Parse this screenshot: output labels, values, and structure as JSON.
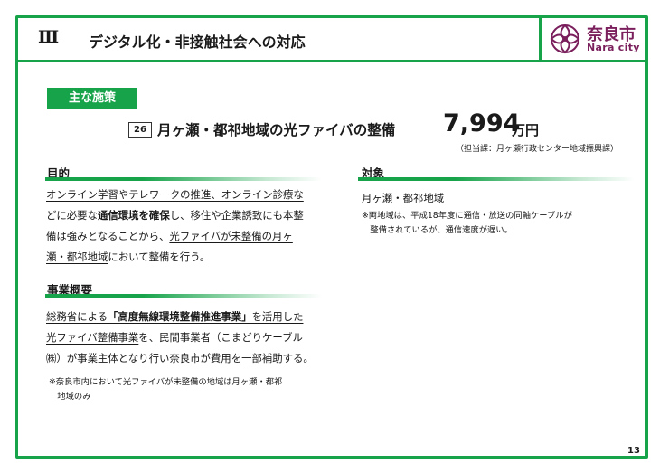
{
  "header": {
    "section_number": "Ⅲ",
    "title": "デジタル化・非接触社会への対応",
    "logo": {
      "name_jp": "奈良市",
      "name_en": "Nara city"
    }
  },
  "badge": "主な施策",
  "project": {
    "number": "26",
    "title": "月ヶ瀬・都祁地域の光ファイバの整備",
    "amount": "7,994",
    "amount_unit": "万円",
    "department": "（担当課：月ヶ瀬行政センター地域振興課）"
  },
  "purpose": {
    "heading": "目的",
    "lines": [
      [
        "オンライン学習やテレワークの推進、オンライン診療な"
      ],
      [
        "どに必要な",
        "通信環境を確保",
        "し、移住や企業誘致にも本整"
      ],
      [
        "備は強みとなることから、",
        "光ファイバが未整備の月ヶ"
      ],
      [
        "瀬・都祁地域",
        "において整備を行う。"
      ]
    ]
  },
  "overview": {
    "heading": "事業概要",
    "lines": [
      [
        "総務省による",
        "「高度無線環境整備推進事業」",
        "を活用した"
      ],
      [
        "光ファイバ整備事業",
        "を、民間事業者（こまどりケーブル"
      ],
      [
        "㈱）が事業主体となり行い奈良市が費用を一部補助する。"
      ]
    ],
    "note_lines": [
      "※奈良市内において光ファイバが未整備の地域は月ヶ瀬・都祁",
      "　地域のみ"
    ]
  },
  "target": {
    "heading": "対象",
    "text": "月ヶ瀬・都祁地域",
    "note_lines": [
      "※両地域は、平成18年度に通信・放送の同軸ケーブルが",
      "　整備されているが、通信速度が遅い。"
    ]
  },
  "page_number": "13",
  "colors": {
    "accent": "#16a34a",
    "logo": "#7a1f5c"
  }
}
